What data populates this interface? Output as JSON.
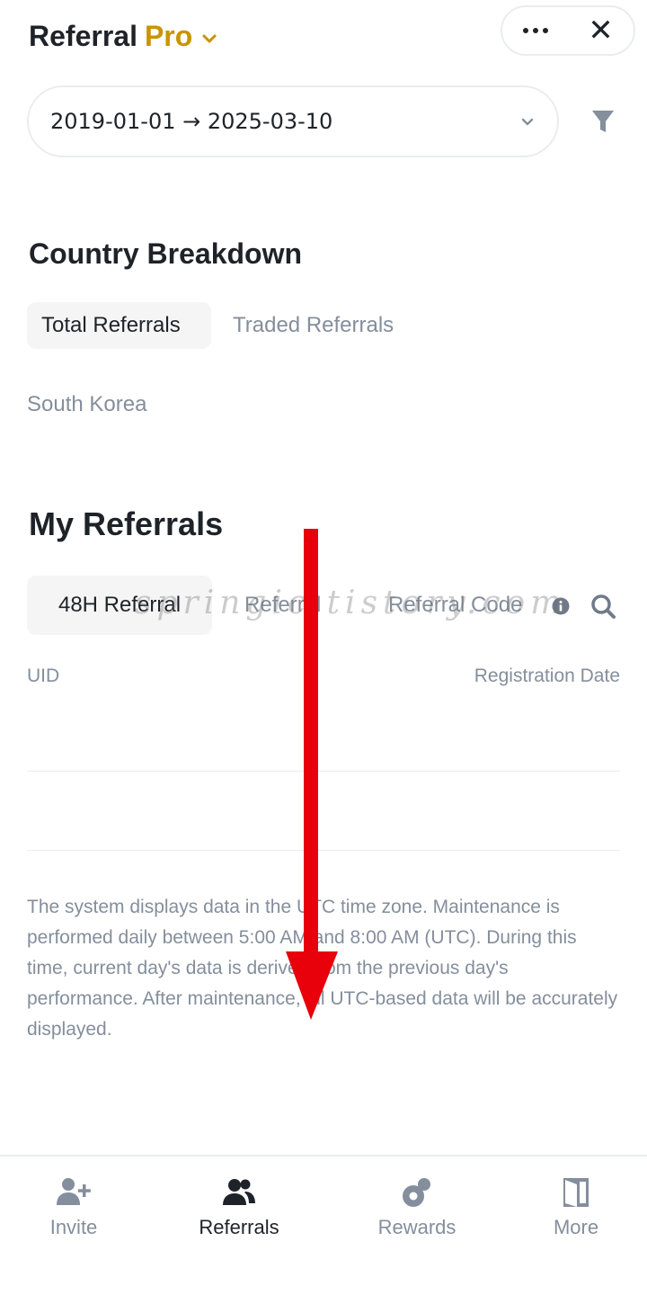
{
  "header": {
    "title": "Referral",
    "title_accent": "Pro",
    "accent_color": "#C99400"
  },
  "date_filter": {
    "value": "2019-01-01 → 2025-03-10"
  },
  "country_breakdown": {
    "title": "Country Breakdown",
    "tabs": [
      {
        "label": "Total Referrals",
        "active": true
      },
      {
        "label": "Traded Referrals",
        "active": false
      }
    ],
    "countries": [
      "South Korea"
    ]
  },
  "my_referrals": {
    "title": "My Referrals",
    "tabs": [
      {
        "label": "48H Referral",
        "active": true
      },
      {
        "label": "Referral",
        "active": false
      },
      {
        "label": "Referral Code",
        "active": false
      }
    ],
    "columns": [
      "UID",
      "Registration Date"
    ],
    "notice": "The system displays data in the UTC time zone. Maintenance is performed daily between 5:00 AM and 8:00 AM (UTC). During this time, current day's data is derived from the previous day's performance. After maintenance, all UTC-based data will be accurately displayed."
  },
  "watermark": "springic.tistory.com",
  "bottom_nav": {
    "items": [
      {
        "label": "Invite",
        "icon": "add-user-icon",
        "active": false
      },
      {
        "label": "Referrals",
        "icon": "users-icon",
        "active": true
      },
      {
        "label": "Rewards",
        "icon": "rewards-icon",
        "active": false
      },
      {
        "label": "More",
        "icon": "more-door-icon",
        "active": false
      }
    ]
  },
  "colors": {
    "text_primary": "#1E2329",
    "text_secondary": "#848E9C",
    "arrow": "#E8000B"
  }
}
